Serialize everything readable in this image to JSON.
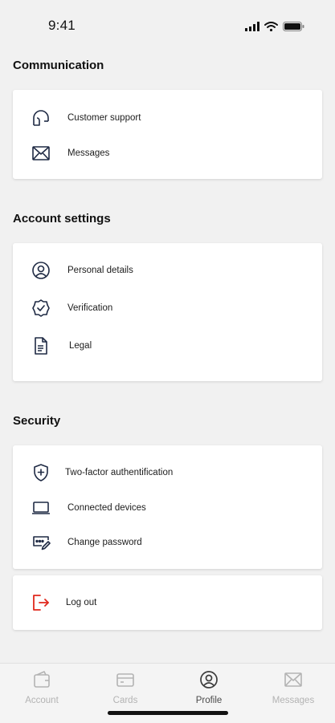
{
  "status_bar": {
    "time": "9:41",
    "icons": [
      "signal-icon",
      "wifi-icon",
      "battery-icon"
    ]
  },
  "sections": {
    "communication": {
      "title": "Communication",
      "items": [
        {
          "label": "Customer support",
          "icon": "headset-icon"
        },
        {
          "label": "Messages",
          "icon": "envelope-icon"
        }
      ]
    },
    "account_settings": {
      "title": "Account settings",
      "items": [
        {
          "label": "Personal details",
          "icon": "user-circle-icon"
        },
        {
          "label": "Verification",
          "icon": "badge-check-icon"
        },
        {
          "label": "Legal",
          "icon": "document-icon"
        }
      ]
    },
    "security": {
      "title": "Security",
      "items": [
        {
          "label": "Two-factor authentification",
          "icon": "shield-plus-icon"
        },
        {
          "label": "Connected devices",
          "icon": "laptop-icon"
        },
        {
          "label": "Change password",
          "icon": "password-icon"
        }
      ]
    },
    "logout": {
      "label": "Log out",
      "icon": "logout-icon",
      "color": "#e0281c"
    }
  },
  "tab_bar": {
    "tabs": [
      {
        "label": "Account",
        "icon": "wallet-icon",
        "active": false
      },
      {
        "label": "Cards",
        "icon": "card-icon",
        "active": false
      },
      {
        "label": "Profile",
        "icon": "user-circle-icon",
        "active": true
      },
      {
        "label": "Messages",
        "icon": "envelope-icon",
        "active": false
      }
    ]
  },
  "colors": {
    "background": "#f1f1f1",
    "icon": "#1f2a44",
    "danger": "#e0281c",
    "tab_inactive": "#b3b3b3",
    "tab_active": "#4a4a4a"
  }
}
